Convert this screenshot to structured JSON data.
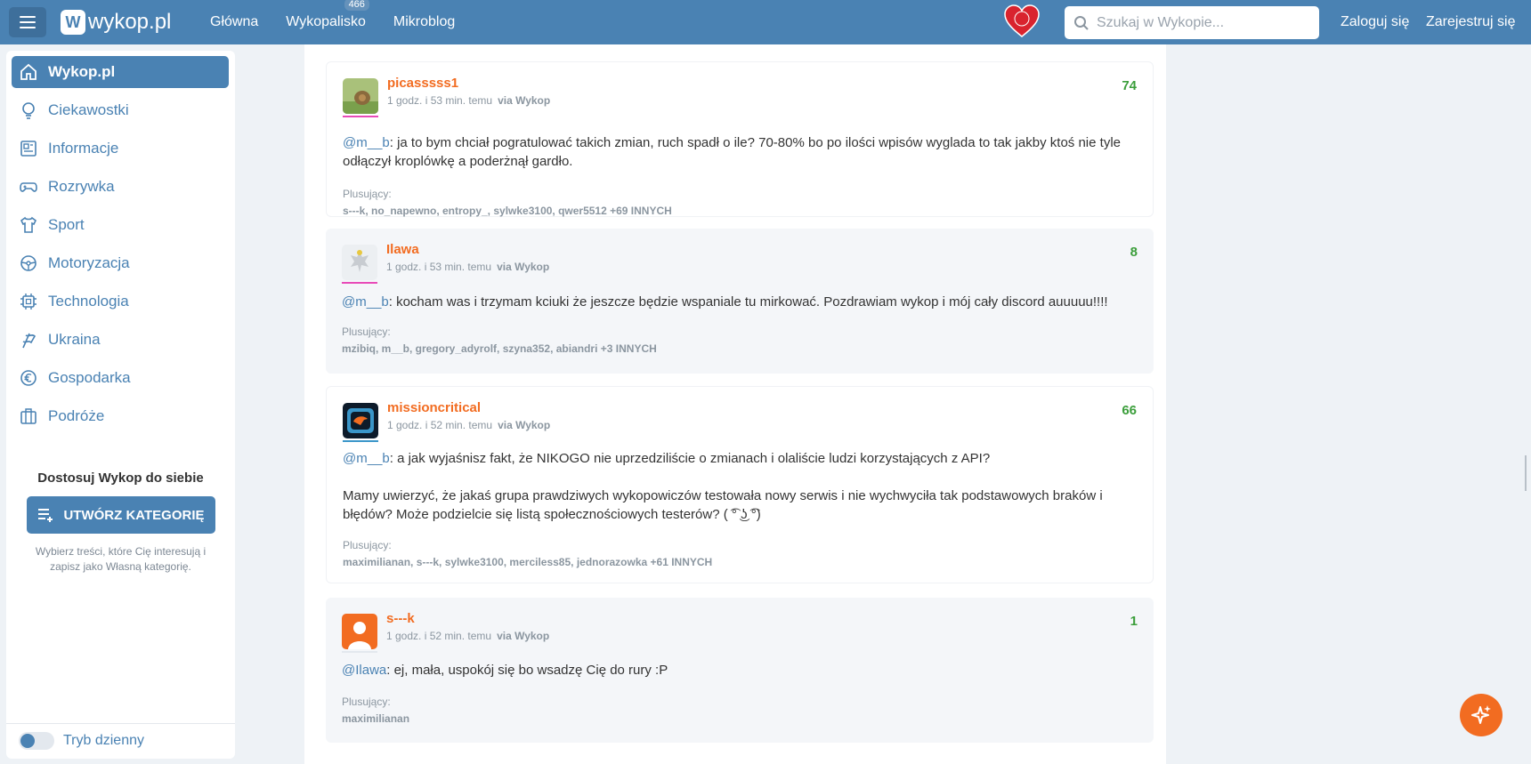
{
  "header": {
    "logo_text": "wykop.pl",
    "nav": [
      {
        "label": "Główna"
      },
      {
        "label": "Wykopalisko",
        "badge": "466"
      },
      {
        "label": "Mikroblog"
      }
    ],
    "search_placeholder": "Szukaj w Wykopie...",
    "login": "Zaloguj się",
    "register": "Zarejestruj się"
  },
  "sidebar": {
    "items": [
      {
        "label": "Wykop.pl",
        "icon": "home-icon"
      },
      {
        "label": "Ciekawostki",
        "icon": "lightbulb-icon"
      },
      {
        "label": "Informacje",
        "icon": "newspaper-icon"
      },
      {
        "label": "Rozrywka",
        "icon": "gamepad-icon"
      },
      {
        "label": "Sport",
        "icon": "shirt-icon"
      },
      {
        "label": "Motoryzacja",
        "icon": "steering-wheel-icon"
      },
      {
        "label": "Technologia",
        "icon": "chip-icon"
      },
      {
        "label": "Ukraina",
        "icon": "flag-icon"
      },
      {
        "label": "Gospodarka",
        "icon": "euro-icon"
      },
      {
        "label": "Podróże",
        "icon": "suitcase-icon"
      }
    ],
    "customize_title": "Dostosuj Wykop do siebie",
    "create_button": "UTWÓRZ KATEGORIĘ",
    "customize_desc": "Wybierz treści, które Cię interesują i zapisz jako Własną kategorię.",
    "day_mode": "Tryb dzienny"
  },
  "comments": [
    {
      "author": "picasssss1",
      "time": "1 godz. i 53 min. temu",
      "via": "via Wykop",
      "votes": "74",
      "mention": "@m__b",
      "text": ": ja to bym chciał pogratulować takich zmian, ruch spadł o ile? 70-80% bo po ilości wpisów wyglada to tak jakby ktoś nie tyle odłączył kroplówkę a poderżnął gardło.",
      "plus_label": "Plusujący:",
      "plus_list": "s---k, no_napewno, entropy_, sylwke3100, qwer5512 +69 INNYCH"
    },
    {
      "author": "Ilawa",
      "time": "1 godz. i 53 min. temu",
      "via": "via Wykop",
      "votes": "8",
      "mention": "@m__b",
      "text": ": kocham was i trzymam kciuki że jeszcze będzie wspaniale tu mirkować. Pozdrawiam wykop i mój cały discord auuuuu!!!!",
      "plus_label": "Plusujący:",
      "plus_list": "mzibiq, m__b, gregory_adyrolf, szyna352, abiandri +3 INNYCH"
    },
    {
      "author": "missioncritical",
      "time": "1 godz. i 52 min. temu",
      "via": "via Wykop",
      "votes": "66",
      "mention": "@m__b",
      "text": ": a jak wyjaśnisz fakt, że NIKOGO nie uprzedziliście o zmianach i olaliście ludzi korzystających z API?",
      "text2": "Mamy uwierzyć, że jakaś grupa prawdziwych wykopowiczów testowała nowy serwis i nie wychwyciła tak podstawowych braków i błędów? Może podzielcie się listą społecznościowych testerów? ( ͡° ͜ʖ ͡°)",
      "plus_label": "Plusujący:",
      "plus_list": "maximilianan, s---k, sylwke3100, merciless85, jednorazowka +61 INNYCH"
    },
    {
      "author": "s---k",
      "time": "1 godz. i 52 min. temu",
      "via": "via Wykop",
      "votes": "1",
      "mention": "@Ilawa",
      "text": ": ej, mała, uspokój się bo wsadzę Cię do rury :P",
      "plus_label": "Plusujący:",
      "plus_list": "maximilianan"
    }
  ]
}
